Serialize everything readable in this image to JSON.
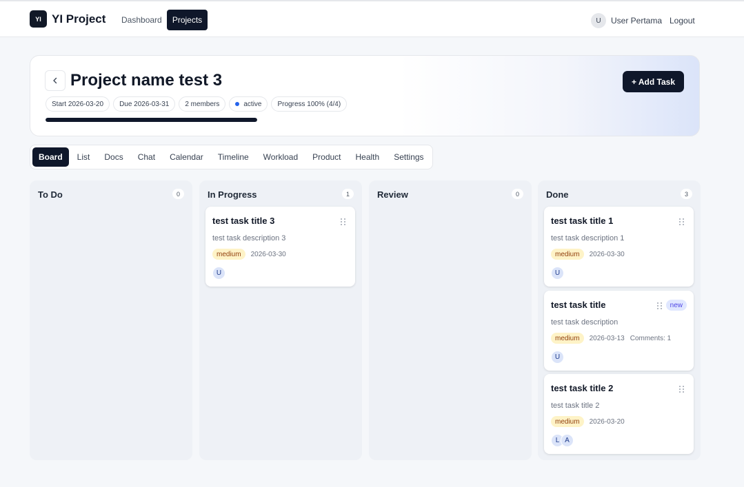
{
  "app": {
    "logo_mark": "YI",
    "name": "YI Project"
  },
  "nav": {
    "dashboard": "Dashboard",
    "projects": "Projects"
  },
  "user": {
    "avatar_initial": "U",
    "name": "User Pertama",
    "logout": "Logout"
  },
  "project": {
    "back_icon": "chevron-left-icon",
    "title": "Project name test 3",
    "start": "Start 2026-03-20",
    "due": "Due 2026-03-31",
    "members": "2 members",
    "status": "active",
    "progress_label": "Progress 100% (4/4)",
    "progress_value": 1.0,
    "add_task": "+ Add Task"
  },
  "tabs": [
    {
      "label": "Board",
      "active": true
    },
    {
      "label": "List"
    },
    {
      "label": "Docs"
    },
    {
      "label": "Chat"
    },
    {
      "label": "Calendar"
    },
    {
      "label": "Timeline"
    },
    {
      "label": "Workload"
    },
    {
      "label": "Product"
    },
    {
      "label": "Health"
    },
    {
      "label": "Settings"
    }
  ],
  "columns": [
    {
      "title": "To Do",
      "count": "0",
      "tasks": []
    },
    {
      "title": "In Progress",
      "count": "1",
      "tasks": [
        {
          "title": "test task title 3",
          "description": "test task description 3",
          "priority": "medium",
          "due": "2026-03-30",
          "assignees": [
            "U"
          ]
        }
      ]
    },
    {
      "title": "Review",
      "count": "0",
      "tasks": []
    },
    {
      "title": "Done",
      "count": "3",
      "tasks": [
        {
          "title": "test task title 1",
          "description": "test task description 1",
          "priority": "medium",
          "due": "2026-03-30",
          "assignees": [
            "U"
          ]
        },
        {
          "title": "test task title",
          "badge": "new",
          "description": "test task description",
          "priority": "medium",
          "due": "2026-03-13",
          "comments": "Comments: 1",
          "assignees": [
            "U"
          ]
        },
        {
          "title": "test task title 2",
          "description": "test task title 2",
          "priority": "medium",
          "due": "2026-03-20",
          "assignees": [
            "L",
            "A"
          ]
        }
      ]
    }
  ],
  "colors": {
    "primary": "#0f172a",
    "status_active": "#2563eb",
    "priority_medium_bg": "#fef3c7",
    "page_bg": "#f5f7fa",
    "column_bg": "#eef1f6"
  }
}
